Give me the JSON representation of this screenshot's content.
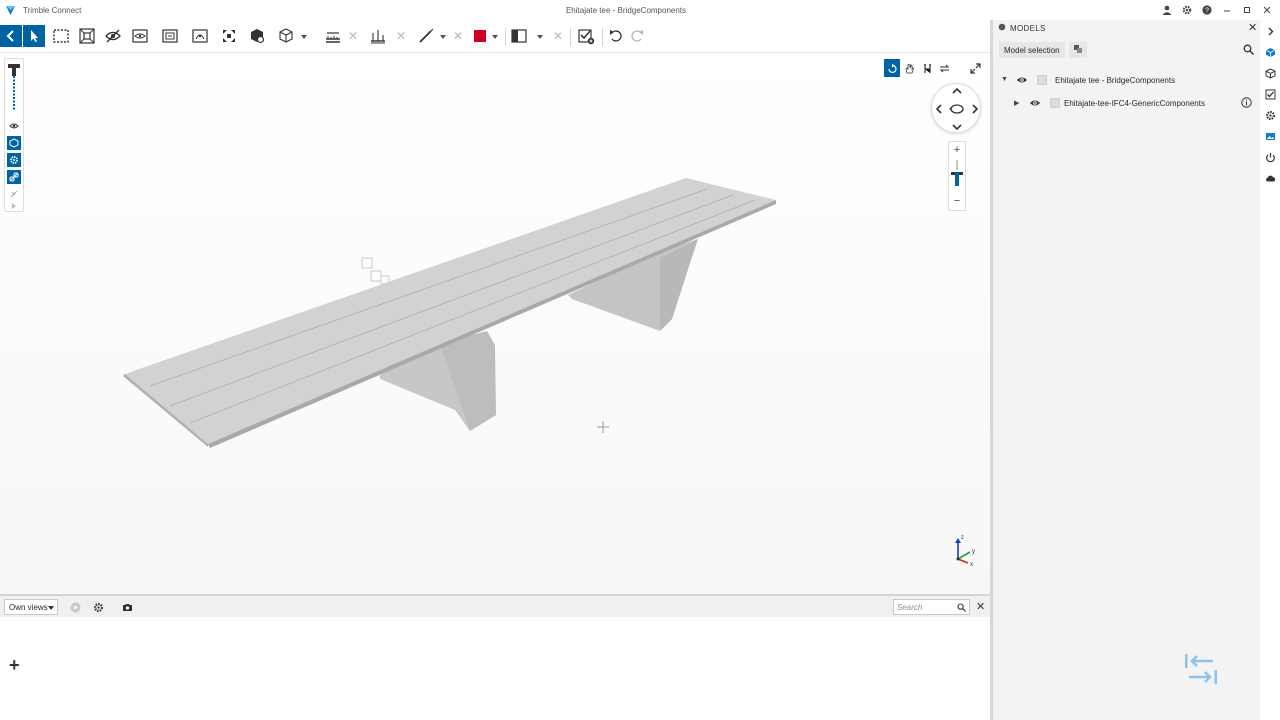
{
  "window": {
    "app_name": "Trimble Connect",
    "title": "Ehitajate tee - BridgeComponents"
  },
  "toolbar": {
    "tools": [
      "back",
      "select",
      "area-select",
      "fit-selection",
      "hide",
      "section-box",
      "section-plane",
      "clip",
      "fit-all",
      "object-explode",
      "view-cube",
      "measure",
      "measure-point",
      "markup-line",
      "color-picker",
      "split-view",
      "visibility-check",
      "undo",
      "redo"
    ],
    "accent_color": "#0063a3",
    "markup_color": "#d0021b"
  },
  "viewport": {
    "background": "#f7f7f7",
    "model_color": "#cfcfcf"
  },
  "views": {
    "dropdown_value": "Own views",
    "search_placeholder": "Search",
    "add_label": "+"
  },
  "models_panel": {
    "title": "MODELS",
    "tab_label": "Model selection",
    "tree": [
      {
        "name": "Ehitajate tee - BridgeComponents",
        "expanded": true,
        "level": 0
      },
      {
        "name": "Ehitajate-tee-IFC4-GenericComponents",
        "expanded": false,
        "level": 1
      }
    ]
  },
  "right_strip": {
    "icons": [
      "chevron-right",
      "models",
      "objects",
      "todo",
      "clash",
      "image",
      "history",
      "cloud"
    ]
  }
}
